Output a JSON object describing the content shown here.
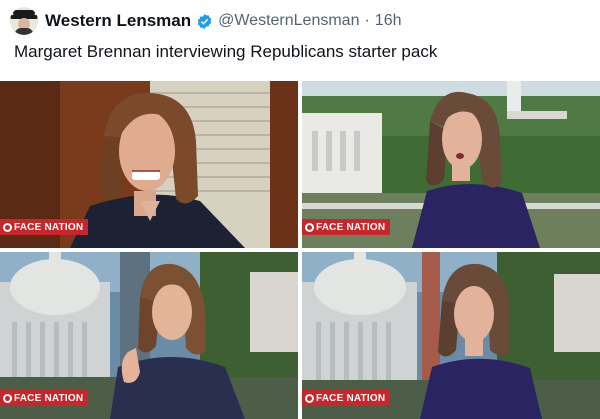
{
  "post": {
    "author_name": "Western Lensman",
    "author_handle": "@WesternLensman",
    "separator": "·",
    "time": "16h",
    "text": "Margaret Brennan interviewing Republicans starter pack"
  },
  "media": {
    "tiles": [
      {
        "badge": "FACE NATION"
      },
      {
        "badge": "FACE NATION"
      },
      {
        "badge": "FACE NATION"
      },
      {
        "badge": "FACE NATION"
      }
    ]
  },
  "colors": {
    "verified": "#1d9bf0",
    "badge": "#c8262b",
    "outfit": "#2b2462"
  }
}
